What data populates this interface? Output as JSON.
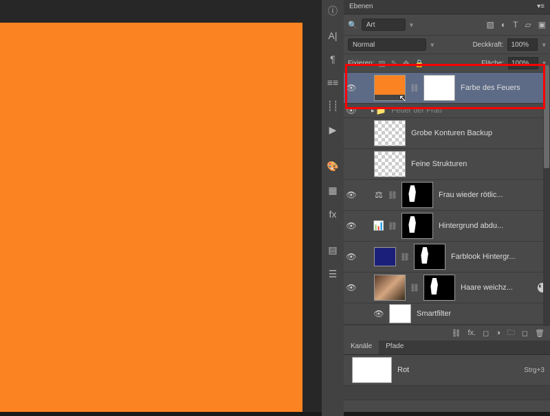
{
  "panel_title": "Ebenen",
  "search_mode": "Art",
  "blend_mode": "Normal",
  "opacity_label": "Deckkraft:",
  "opacity_value": "100%",
  "lock_label": "Fixieren:",
  "fill_label": "Fläche:",
  "fill_value": "100%",
  "layers": [
    {
      "name": "Farbe des Feuers"
    },
    {
      "name": "Feuer der Frau"
    },
    {
      "name": "Grobe Konturen Backup"
    },
    {
      "name": "Feine Strukturen"
    },
    {
      "name": "Frau wieder rötlic..."
    },
    {
      "name": "Hintergrund abdu..."
    },
    {
      "name": "Farblook Hintergr..."
    },
    {
      "name": "Haare weichz..."
    },
    {
      "name": "Smartfilter"
    }
  ],
  "channels_tab": "Kanäle",
  "paths_tab": "Pfade",
  "channels": [
    {
      "name": "Rot",
      "key": "Strg+3"
    }
  ],
  "vstrip": [
    "ⓘ",
    "A|",
    "¶",
    "≡≡",
    "┊┊",
    "▶",
    "",
    "",
    "🎨",
    "▦",
    "fx",
    "",
    "",
    "▤",
    "☰"
  ]
}
